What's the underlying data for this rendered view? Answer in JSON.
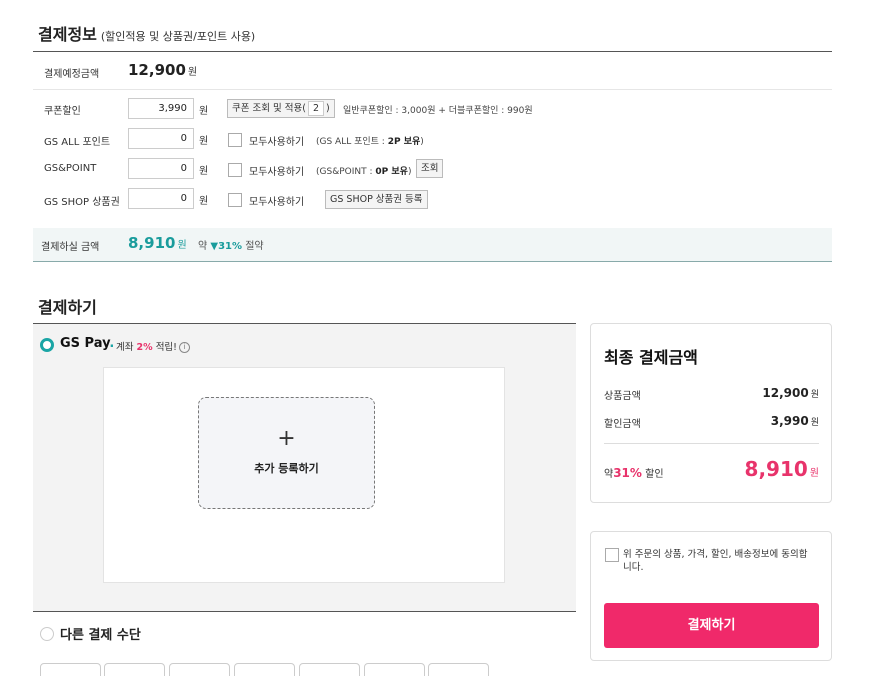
{
  "payment_info": {
    "title": "결제정보",
    "subtitle": "(할인적용 및 상품권/포인트 사용)",
    "expected_label": "결제예정금액",
    "expected_amount": "12,900",
    "unit_won": "원",
    "coupon": {
      "label": "쿠폰할인",
      "value": "3,990",
      "button_prefix": "쿠폰 조회 및 적용(",
      "button_count": "2",
      "button_suffix": ")",
      "detail": "일반쿠폰할인 : 3,000원 + 더블쿠폰할인 : 990원"
    },
    "gs_all_point": {
      "label": "GS ALL 포인트",
      "value": "0",
      "use_all_label": "모두사용하기",
      "note_prefix": "(GS ALL 포인트 : ",
      "note_value": "2P 보유",
      "note_suffix": ")"
    },
    "gs_and_point": {
      "label": "GS&POINT",
      "value": "0",
      "use_all_label": "모두사용하기",
      "note_prefix": "(GS&POINT : ",
      "note_value": "0P 보유",
      "note_suffix": ")",
      "lookup_button": "조회"
    },
    "gift_card": {
      "label": "GS SHOP 상품권",
      "value": "0",
      "use_all_label": "모두사용하기",
      "register_button": "GS SHOP 상품권 등록"
    },
    "total": {
      "label": "결제하실 금액",
      "amount": "8,910",
      "save_prefix": "약",
      "save_arrow": "▼",
      "save_pct": "31%",
      "save_suffix": "절약"
    }
  },
  "payment_method": {
    "title": "결제하기",
    "gspay": {
      "logo_text": "GS Pay",
      "logo_dot": ".",
      "desc_prefix": "계좌",
      "desc_pct": "2%",
      "desc_suffix": "적립!",
      "info_glyph": "i",
      "add_plus": "+",
      "add_label": "추가 등록하기"
    },
    "other_label": "다른 결제 수단"
  },
  "summary": {
    "title": "최종 결제금액",
    "product_label": "상품금액",
    "product_amount": "12,900",
    "discount_label": "할인금액",
    "discount_amount": "3,990",
    "disc_prefix": "약",
    "disc_pct": "31%",
    "disc_suffix": "할인",
    "final_amount": "8,910",
    "unit_won": "원"
  },
  "agreement": {
    "text": "위 주문의 상품, 가격, 할인, 배송정보에 동의합니다.",
    "pay_button": "결제하기"
  },
  "colors": {
    "accent_teal": "#1aa5a5",
    "accent_pink": "#f0296a"
  }
}
